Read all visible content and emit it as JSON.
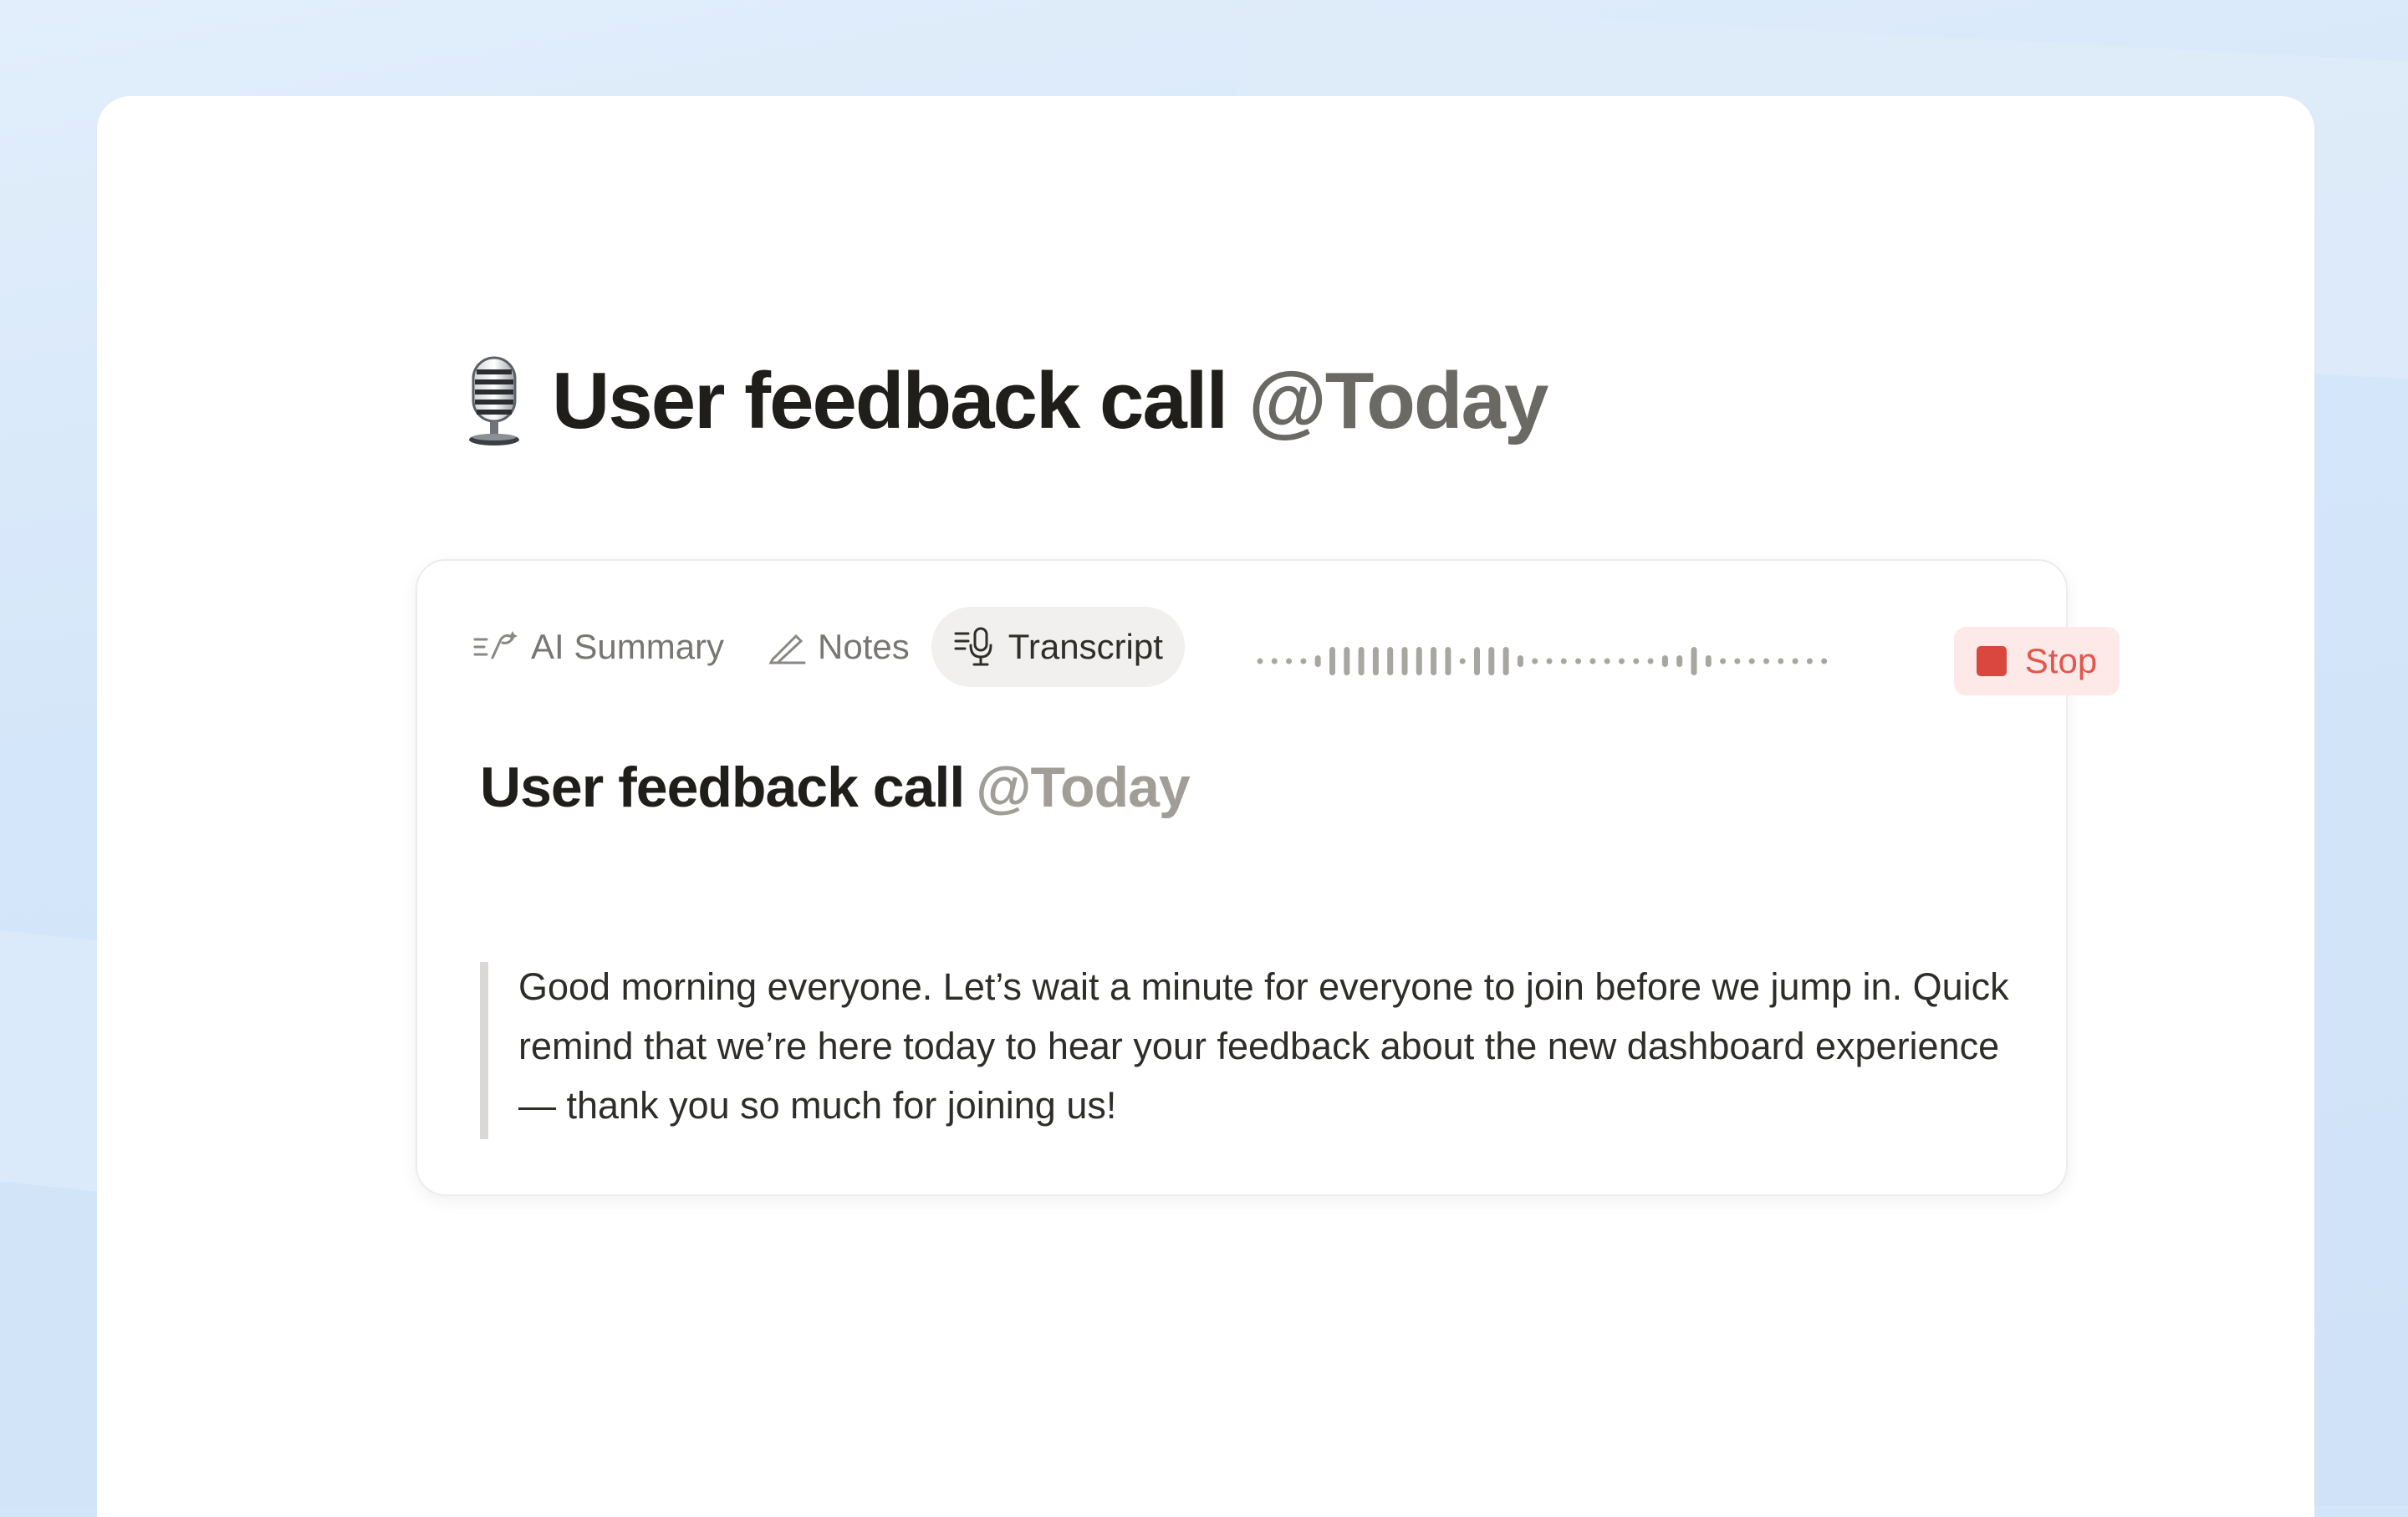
{
  "page": {
    "title_emoji": "studio-microphone",
    "title": "User feedback call",
    "title_mention": "@Today"
  },
  "meeting_block": {
    "tabs": [
      {
        "label": "AI Summary",
        "icon": "ai-summary-icon",
        "active": false
      },
      {
        "label": "Notes",
        "icon": "pencil-icon",
        "active": false
      },
      {
        "label": "Transcript",
        "icon": "transcript-mic-icon",
        "active": true
      }
    ],
    "stop_label": "Stop",
    "heading": "User feedback call",
    "heading_mention": "@Today",
    "transcript_text": "Good morning everyone. Let’s wait a minute for everyone to join before we jump in. Quick remind that we’re here today to hear your feedback about the new dashboard experience — thank you so much for joining us!"
  },
  "colors": {
    "background": "#d3e5f8",
    "stop_accent": "#d9473f",
    "mention": "#a19d97"
  }
}
